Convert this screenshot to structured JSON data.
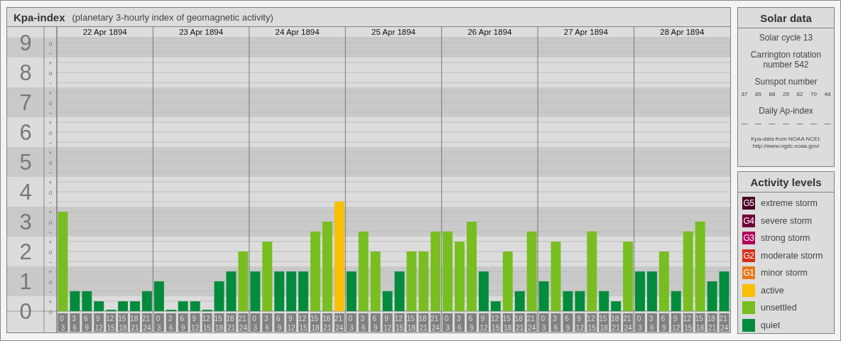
{
  "panel": {
    "title": "Kpa-index",
    "subtitle": "(planetary 3-hourly index of geomagnetic activity)",
    "scale_marks": [
      "o",
      "−",
      "+",
      "o",
      "−",
      "+",
      "o",
      "−",
      "+",
      "o",
      "−",
      "+",
      "o",
      "−",
      "+",
      "o",
      "−",
      "+",
      "o",
      "−",
      "+",
      "o",
      "−",
      "+",
      "o",
      "−",
      "+",
      "o"
    ],
    "dates": [
      "22 Apr 1894",
      "23 Apr 1894",
      "24 Apr 1894",
      "25 Apr 1894",
      "26 Apr 1894",
      "27 Apr 1894",
      "28 Apr 1894"
    ],
    "chart_data": {
      "type": "bar",
      "ylim": [
        0,
        9.17
      ],
      "grid": true,
      "bands": [
        {
          "axis": "y",
          "from": 0.5,
          "to": 1.5,
          "color": "#c9c9c9"
        },
        {
          "axis": "y",
          "from": 2.5,
          "to": 3.5,
          "color": "#c9c9c9"
        },
        {
          "axis": "y",
          "from": 4.5,
          "to": 5.5,
          "color": "#c9c9c9"
        },
        {
          "axis": "y",
          "from": 6.5,
          "to": 7.5,
          "color": "#c9c9c9"
        },
        {
          "axis": "y",
          "from": 8.5,
          "to": 9.17,
          "color": "#c9c9c9"
        }
      ],
      "yticks": [
        0,
        1,
        2,
        3,
        4,
        5,
        6,
        7,
        8,
        9
      ],
      "categories": [
        "0 3",
        "3 6",
        "6 9",
        "9 12",
        "12 15",
        "15 18",
        "18 21",
        "21 24",
        "0 3",
        "3 6",
        "6 9",
        "9 12",
        "12 15",
        "15 18",
        "18 21",
        "21 24",
        "0 3",
        "3 6",
        "6 9",
        "9 12",
        "12 15",
        "15 18",
        "18 21",
        "21 24",
        "0 3",
        "3 6",
        "6 9",
        "9 12",
        "12 15",
        "15 18",
        "18 21",
        "21 24",
        "0 3",
        "3 6",
        "6 9",
        "9 12",
        "12 15",
        "15 18",
        "18 21",
        "21 24",
        "0 3",
        "3 6",
        "6 9",
        "9 12",
        "12 15",
        "15 18",
        "18 21",
        "21 24",
        "0 3",
        "3 6",
        "6 9",
        "9 12",
        "12 15",
        "15 18",
        "18 21",
        "21 24"
      ],
      "series": [
        {
          "name": "active",
          "color": "#f8c000",
          "values": [
            null,
            null,
            null,
            null,
            null,
            null,
            null,
            null,
            null,
            null,
            null,
            null,
            null,
            null,
            null,
            null,
            null,
            null,
            null,
            null,
            null,
            null,
            null,
            3.67,
            null,
            null,
            null,
            null,
            null,
            null,
            null,
            null,
            null,
            null,
            null,
            null,
            null,
            null,
            null,
            null,
            null,
            null,
            null,
            null,
            null,
            null,
            null,
            null,
            null,
            null,
            null,
            null,
            null,
            null,
            null,
            null
          ]
        },
        {
          "name": "unsettled",
          "color": "#78be20",
          "values": [
            3.33,
            null,
            null,
            null,
            null,
            null,
            null,
            null,
            null,
            null,
            null,
            null,
            null,
            null,
            null,
            2,
            null,
            2.33,
            null,
            null,
            null,
            2.67,
            3,
            null,
            null,
            2.67,
            2,
            null,
            null,
            2,
            2,
            2.67,
            2.67,
            2.33,
            3,
            null,
            null,
            2,
            null,
            2.67,
            null,
            2.33,
            null,
            null,
            2.67,
            null,
            null,
            2.33,
            null,
            null,
            2,
            null,
            2.67,
            3,
            null,
            null
          ]
        },
        {
          "name": "quiet",
          "color": "#008c3c",
          "values": [
            null,
            0.67,
            0.67,
            0.33,
            0,
            0.33,
            0.33,
            0.67,
            1,
            0,
            0.33,
            0.33,
            0,
            1,
            1.33,
            null,
            1.33,
            null,
            1.33,
            1.33,
            1.33,
            null,
            null,
            null,
            1.33,
            null,
            null,
            0.67,
            1.33,
            null,
            null,
            null,
            null,
            null,
            null,
            1.33,
            0.33,
            null,
            0.67,
            null,
            1,
            null,
            0.67,
            0.67,
            null,
            0.67,
            0.33,
            null,
            1.33,
            1.33,
            null,
            0.67,
            null,
            null,
            1,
            1.33
          ]
        }
      ]
    }
  },
  "solar_data": {
    "title": "Solar data",
    "solar_cycle": "Solar cycle 13",
    "carrington": "Carrington rotation number 542",
    "sunspot_title": "Sunspot number",
    "sunspots": [
      "37",
      "85",
      "88",
      "25",
      "62",
      "70",
      "48"
    ],
    "ap_title": "Daily Ap-index",
    "ap_values": [
      "—",
      "—",
      "—",
      "—",
      "—",
      "—",
      "—"
    ],
    "source": "Kpa-data from NOAA NCEI:",
    "source_url": "http://www.ngdc.noaa.gov/"
  },
  "activity_levels": {
    "title": "Activity levels",
    "items": [
      {
        "badge": "G5",
        "label": "extreme storm",
        "color": "#4a0024"
      },
      {
        "badge": "G4",
        "label": "severe storm",
        "color": "#72003c"
      },
      {
        "badge": "G3",
        "label": "strong storm",
        "color": "#b0005a"
      },
      {
        "badge": "G2",
        "label": "moderate storm",
        "color": "#d83018"
      },
      {
        "badge": "G1",
        "label": "minor storm",
        "color": "#e87818"
      }
    ]
  }
}
